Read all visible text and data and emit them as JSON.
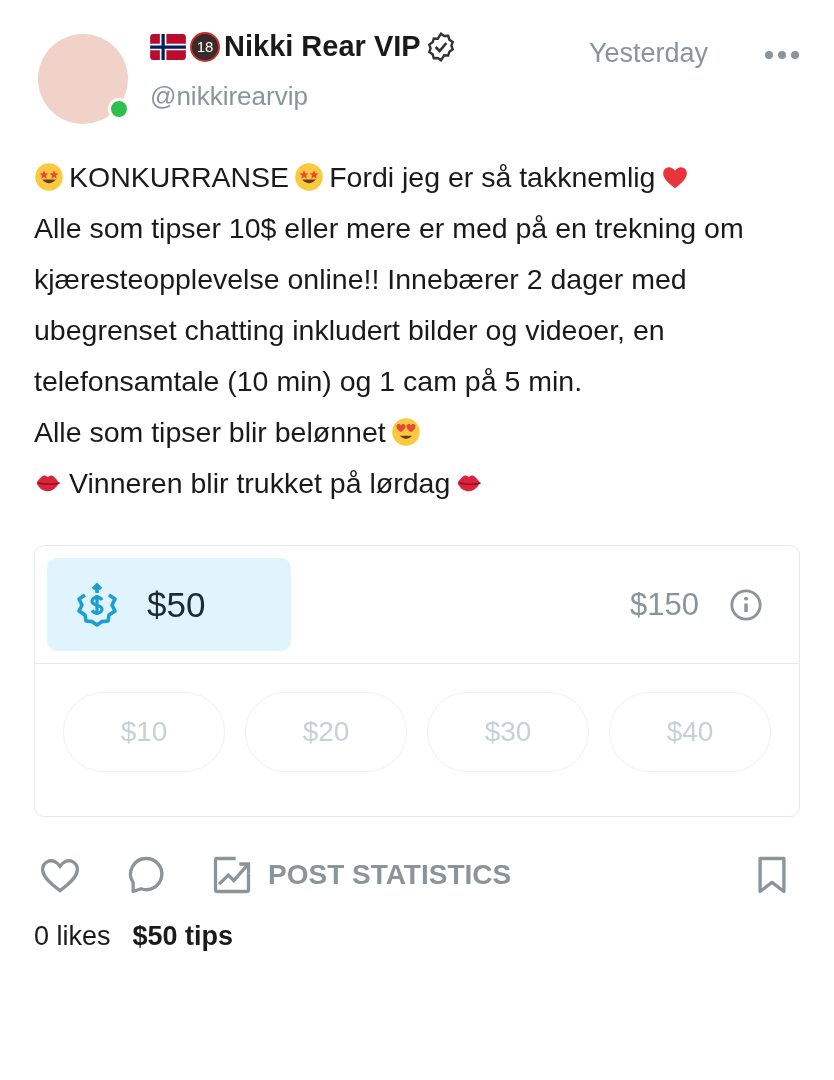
{
  "post": {
    "author": {
      "name": "Nikki Rear VIP",
      "age_badge": "18",
      "verified": true,
      "online": true,
      "handle": "@nikkirearvip"
    },
    "time": "Yesterday",
    "body": [
      {
        "parts": [
          {
            "kind": "starstruck"
          },
          {
            "kind": "text",
            "text": "KONKURRANSE"
          },
          {
            "kind": "starstruck"
          },
          {
            "kind": "text",
            "text": "Fordi jeg er så takknemlig"
          },
          {
            "kind": "heart"
          }
        ]
      },
      {
        "parts": [
          {
            "kind": "text",
            "text": "Alle som tipser 10$ eller mere er med på en trekning om kjæresteopplevelse online!! Innebærer 2 dager med ubegrenset chatting inkludert bilder og videoer, en telefonsamtale (10 min) og 1 cam på 5 min."
          }
        ]
      },
      {
        "parts": [
          {
            "kind": "text",
            "text": "Alle som tipser blir belønnet"
          },
          {
            "kind": "hearteyes"
          }
        ]
      },
      {
        "parts": [
          {
            "kind": "kiss"
          },
          {
            "kind": "text",
            "text": "Vinneren blir trukket på lørdag"
          },
          {
            "kind": "kiss"
          }
        ]
      }
    ],
    "tip": {
      "raised": "$50",
      "goal": "$150",
      "amounts": [
        {
          "label": "$10",
          "selected": false
        },
        {
          "label": "$20",
          "selected": false
        },
        {
          "label": "$30",
          "selected": false
        },
        {
          "label": "$40",
          "selected": false
        }
      ]
    },
    "actions": {
      "liked": false,
      "bookmarked": false,
      "statistics": "POST STATISTICS"
    },
    "likes": "0 likes",
    "tips": "$50 tips"
  }
}
